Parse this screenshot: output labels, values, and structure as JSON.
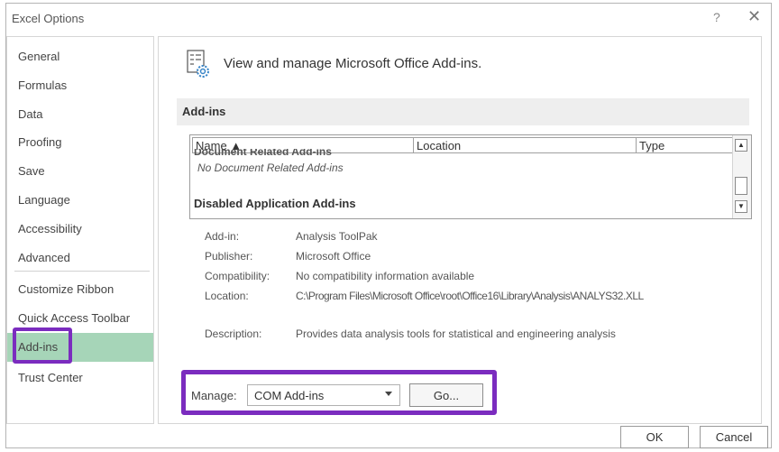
{
  "window": {
    "title": "Excel Options",
    "help_glyph": "?",
    "close_glyph": "✕"
  },
  "sidebar": {
    "items": [
      {
        "label": "General"
      },
      {
        "label": "Formulas"
      },
      {
        "label": "Data"
      },
      {
        "label": "Proofing"
      },
      {
        "label": "Save"
      },
      {
        "label": "Language"
      },
      {
        "label": "Accessibility"
      },
      {
        "label": "Advanced"
      },
      {
        "label": "Customize Ribbon"
      },
      {
        "label": "Quick Access Toolbar"
      },
      {
        "label": "Add-ins"
      },
      {
        "label": "Trust Center"
      }
    ],
    "selected": "Add-ins"
  },
  "main": {
    "header_text": "View and manage Microsoft Office Add-ins.",
    "section_title": "Add-ins",
    "list": {
      "columns": [
        "Name ▲",
        "Location",
        "Type"
      ],
      "cut_group": "Document Related Add-ins",
      "empty_message": "No Document Related Add-ins",
      "group_label": "Disabled Application Add-ins"
    },
    "details": {
      "addin_label": "Add-in:",
      "addin_value": "Analysis ToolPak",
      "publisher_label": "Publisher:",
      "publisher_value": "Microsoft Office",
      "compat_label": "Compatibility:",
      "compat_value": "No compatibility information available",
      "location_label": "Location:",
      "location_value": "C:\\Program Files\\Microsoft Office\\root\\Office16\\Library\\Analysis\\ANALYS32.XLL",
      "description_label": "Description:",
      "description_value": "Provides data analysis tools for statistical and engineering analysis"
    },
    "manage": {
      "label": "Manage:",
      "selected": "COM Add-ins",
      "go_label": "Go..."
    }
  },
  "footer": {
    "ok_label": "OK",
    "cancel_label": "Cancel"
  },
  "colors": {
    "highlight": "#7b2cbf",
    "selected_nav": "#a6d5b8"
  }
}
